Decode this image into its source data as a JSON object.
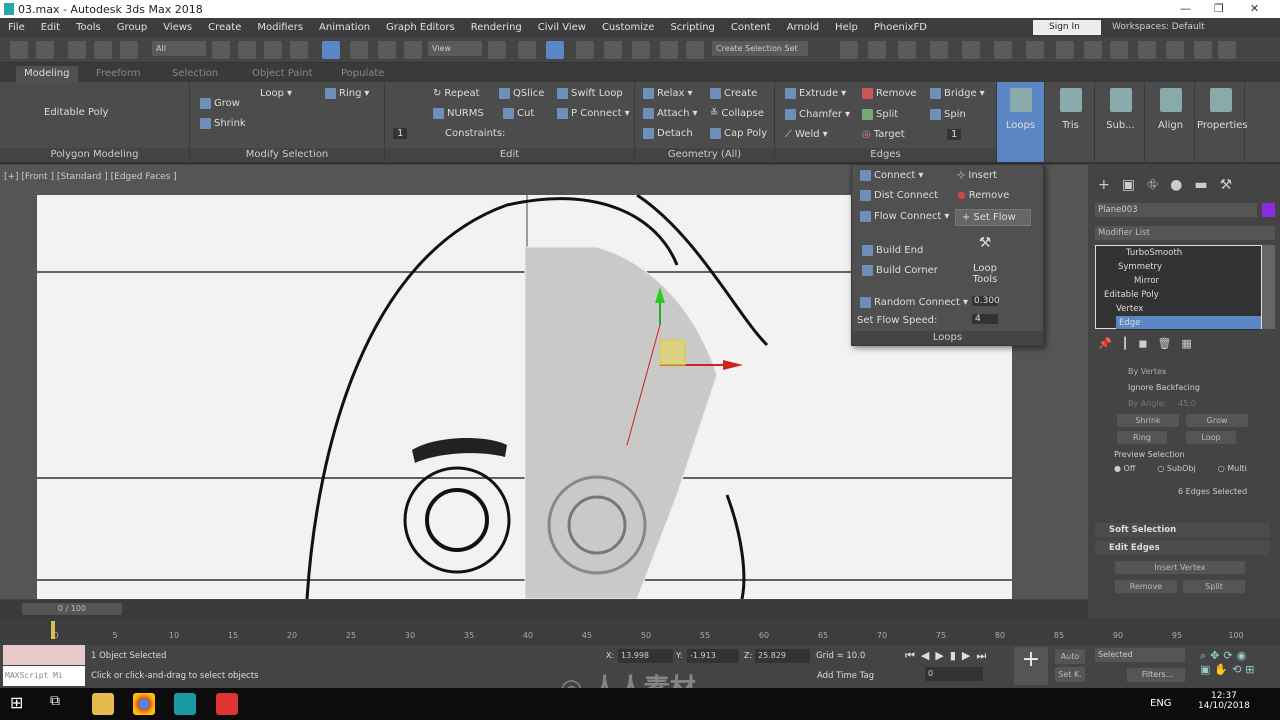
{
  "window": {
    "title": "03.max - Autodesk 3ds Max 2018",
    "minimize": "—",
    "restore": "❐",
    "close": "✕"
  },
  "menus": [
    "File",
    "Edit",
    "Tools",
    "Group",
    "Views",
    "Create",
    "Modifiers",
    "Animation",
    "Graph Editors",
    "Rendering",
    "Civil View",
    "Customize",
    "Scripting",
    "Content",
    "Arnold",
    "Help",
    "PhoenixFD"
  ],
  "signin": "Sign In",
  "workspaces": {
    "label": "Workspaces:",
    "value": "Default"
  },
  "toolbar": {
    "filter": "All",
    "refcoord": "View",
    "selset": "Create Selection Set"
  },
  "tabs": [
    "Modeling",
    "Freeform",
    "Selection",
    "Object Paint",
    "Populate"
  ],
  "ribbon": {
    "polygon_modeling": {
      "title": "Polygon Modeling",
      "object": "Editable Poly"
    },
    "modify_selection": {
      "title": "Modify Selection",
      "grow": "Grow",
      "shrink": "Shrink",
      "loop": "Loop",
      "ring": "Ring"
    },
    "edit": {
      "title": "Edit",
      "repeat": "Repeat",
      "qslice": "QSlice",
      "swiftloop": "Swift Loop",
      "nurms": "NURMS",
      "cut": "Cut",
      "pconnect": "P Connect",
      "constraints": "Constraints:",
      "spin_value": "1"
    },
    "geometry": {
      "title": "Geometry (All)",
      "relax": "Relax",
      "create": "Create",
      "attach": "Attach",
      "collapse": "Collapse",
      "detach": "Detach",
      "cappoly": "Cap Poly"
    },
    "edges": {
      "title": "Edges",
      "extrude": "Extrude",
      "remove": "Remove",
      "bridge": "Bridge",
      "chamfer": "Chamfer",
      "split": "Split",
      "spin": "Spin",
      "weld": "Weld",
      "target": "Target",
      "spin_value": "1"
    },
    "big": [
      "Loops",
      "Tris",
      "Sub...",
      "Align",
      "Properties"
    ]
  },
  "loops_panel": {
    "connect": "Connect",
    "insert": "Insert",
    "dist_connect": "Dist Connect",
    "remove": "Remove",
    "flow_connect": "Flow Connect",
    "set_flow": "Set Flow",
    "build_end": "Build End",
    "build_corner": "Build Corner",
    "loop_tools": "Loop Tools",
    "random_connect": "Random Connect",
    "random_value": "0.300",
    "set_flow_speed": "Set Flow Speed:",
    "speed_value": "4",
    "title": "Loops"
  },
  "viewport": {
    "label": "[+] [Front ] [Standard ] [Edged Faces ]"
  },
  "command_panel": {
    "object_name": "Plane003",
    "object_color": "#8a2be2",
    "modifier_list": "Modifier List",
    "stack": [
      "TurboSmooth",
      "Symmetry",
      "Mirror",
      "Editable Poly",
      "Vertex",
      "Edge"
    ],
    "by_vertex": "By Vertex",
    "ignore_backfacing": "Ignore Backfacing",
    "by_angle": "By Angle:",
    "angle_value": "45.0",
    "shrink": "Shrink",
    "grow": "Grow",
    "ring": "Ring",
    "loop": "Loop",
    "preview_selection": "Preview Selection",
    "preview_options": [
      "Off",
      "SubObj",
      "Multi"
    ],
    "preview_selected": "Off",
    "selected_count": "6 Edges Selected",
    "soft_selection": "Soft Selection",
    "edit_edges": "Edit Edges",
    "insert_vertex": "Insert Vertex",
    "remove": "Remove",
    "split": "Split"
  },
  "timeline": {
    "frame": "0 / 100",
    "ticks": [
      "0",
      "5",
      "10",
      "15",
      "20",
      "25",
      "30",
      "35",
      "40",
      "45",
      "50",
      "55",
      "60",
      "65",
      "70",
      "75",
      "80",
      "85",
      "90",
      "95",
      "100"
    ]
  },
  "status": {
    "maxscript": "MAXScript Mi",
    "selection": "1 Object Selected",
    "prompt": "Click or click-and-drag to select objects",
    "x_label": "X:",
    "x": "13.998",
    "y_label": "Y:",
    "y": "-1.913",
    "z_label": "Z:",
    "z": "25.829",
    "grid": "Grid = 10.0",
    "add_time_tag": "Add Time Tag",
    "current_frame": "0",
    "auto": "Auto",
    "setkey": "Set K.",
    "key_filter": "Selected",
    "filters": "Filters..."
  },
  "taskbar": {
    "lang": "ENG",
    "time": "12:37",
    "date": "14/10/2018"
  },
  "watermark": "人人素材"
}
